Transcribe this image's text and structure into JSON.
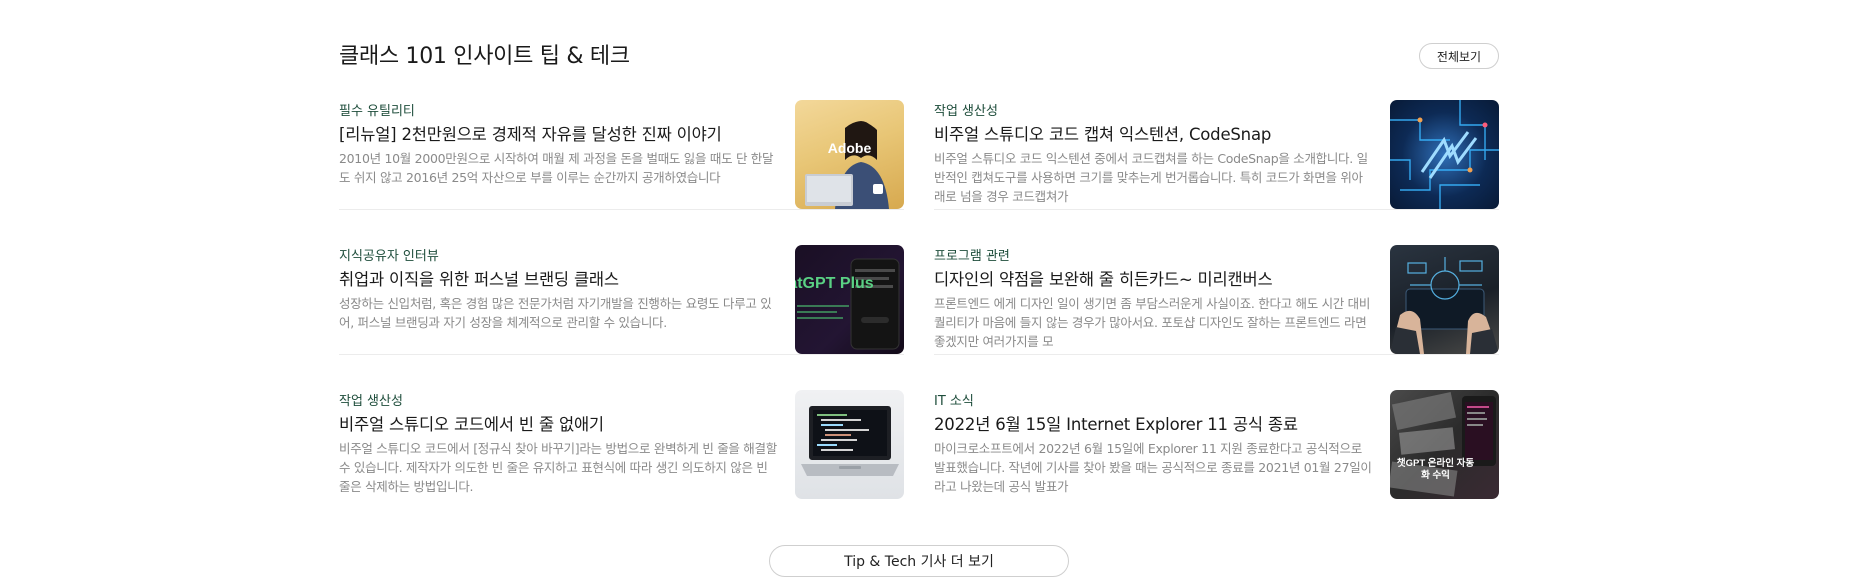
{
  "section": {
    "title": "클래스 101 인사이트 팁 & 테크",
    "view_all_label": "전체보기",
    "more_label": "Tip & Tech 기사 더 보기"
  },
  "articles": [
    {
      "category": "필수 유틸리티",
      "title": "[리뉴얼] 2천만원으로 경제적 자유를 달성한 진짜 이야기",
      "description": "2010년 10월 2000만원으로 시작하여 매월 제 과정을 돈을 벌때도 잃을 때도 단 한달도 쉬지 않고 2016년 25억 자산으로 부를 이루는 순간까지 공개하였습니다",
      "thumb_text": "Adobe"
    },
    {
      "category": "작업 생산성",
      "title": "비주얼 스튜디오 코드 캡쳐 익스텐션, CodeSnap",
      "description": "비주얼 스튜디오 코드 익스텐션 중에서 코드캡쳐를 하는 CodeSnap을 소개합니다. 일반적인 캡쳐도구를 사용하면 크기를 맞추는게 번거롭습니다. 특히 코드가 화면을 위아래로 넘을 경우 코드캡쳐가",
      "thumb_text": ""
    },
    {
      "category": "지식공유자 인터뷰",
      "title": "취업과 이직을 위한 퍼스널 브랜딩 클래스",
      "description": "성장하는 신입처럼, 혹은 경험 많은 전문가처럼 자기개발을 진행하는 요령도 다루고 있어, 퍼스널 브랜딩과 자기 성장을 체계적으로 관리할 수 있습니다.",
      "thumb_text": "ChatGPT Plus"
    },
    {
      "category": "프로그램 관련",
      "title": "디자인의 약점을 보완해 줄 히든카드~ 미리캔버스",
      "description": "프론트엔드 에게 디자인 일이 생기면 좀 부담스러운게 사실이죠. 한다고 해도 시간 대비 퀄리티가 마음에 들지 않는 경우가 많아서요. 포토샵 디자인도 잘하는 프론트엔드 라면 좋겠지만 여러가지를 모",
      "thumb_text": ""
    },
    {
      "category": "작업 생산성",
      "title": "비주얼 스튜디오 코드에서 빈 줄 없애기",
      "description": "비주얼 스튜디오 코드에서 [정규식 찾아 바꾸기]라는 방법으로 완벽하게 빈 줄을 해결할 수 있습니다. 제작자가 의도한 빈 줄은 유지하고 표현식에 따라 생긴 의도하지 않은 빈 줄은 삭제하는 방법입니다.",
      "thumb_text": ""
    },
    {
      "category": "IT 소식",
      "title": "2022년 6월 15일 Internet Explorer 11 공식 종료",
      "description": "마이크로소프트에서 2022년 6월 15일에 Explorer 11 지원 종료한다고 공식적으로 발표했습니다. 작년에 기사를 찾아 봤을 때는 공식적으로 종료를 2021년 01월 27일이라고 나왔는데 공식 발표가",
      "thumb_text": "챗GPT 온라인 자동화 수익"
    }
  ]
}
